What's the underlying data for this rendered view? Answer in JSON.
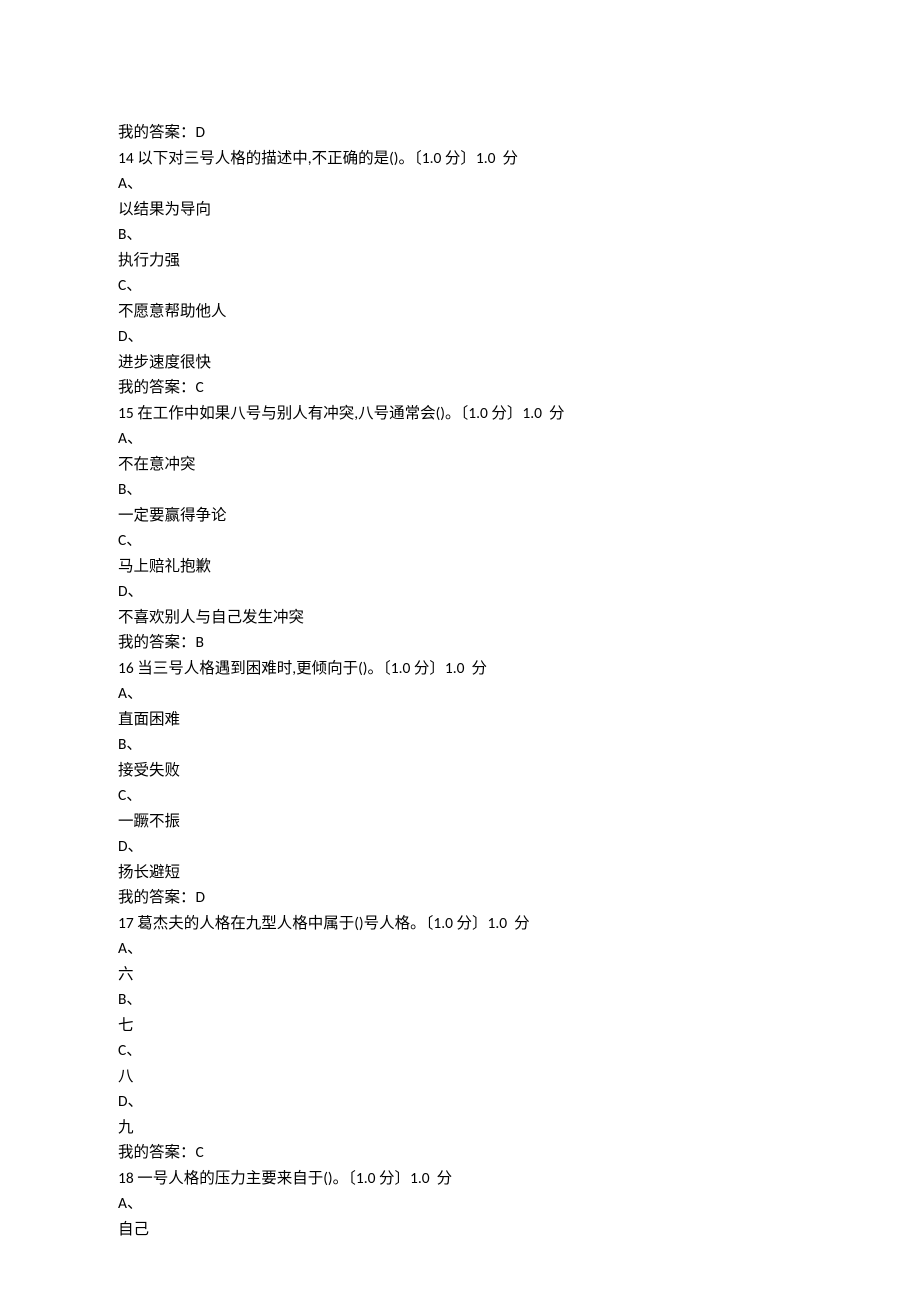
{
  "leading_answer": {
    "label": "我的答案：",
    "value": "D"
  },
  "questions": [
    {
      "num": "14",
      "text": "以下对三号人格的描述中,不正确的是()。",
      "points": "〔1.0 分〕1.0  分",
      "options": {
        "A": "以结果为导向",
        "B": "执行力强",
        "C": "不愿意帮助他人",
        "D": "进步速度很快"
      },
      "answer_label": "我的答案：",
      "answer": "C"
    },
    {
      "num": "15",
      "text": "在工作中如果八号与别人有冲突,八号通常会()。",
      "points": "〔1.0 分〕1.0  分",
      "options": {
        "A": "不在意冲突",
        "B": "一定要赢得争论",
        "C": "马上赔礼抱歉",
        "D": "不喜欢别人与自己发生冲突"
      },
      "answer_label": "我的答案：",
      "answer": "B"
    },
    {
      "num": "16",
      "text": "当三号人格遇到困难时,更倾向于()。",
      "points": "〔1.0 分〕1.0  分",
      "options": {
        "A": "直面困难",
        "B": "接受失败",
        "C": "一蹶不振",
        "D": "扬长避短"
      },
      "answer_label": "我的答案：",
      "answer": "D"
    },
    {
      "num": "17",
      "text": "葛杰夫的人格在九型人格中属于()号人格。",
      "points": "〔1.0 分〕1.0  分",
      "options": {
        "A": "六",
        "B": "七",
        "C": "八",
        "D": "九"
      },
      "answer_label": "我的答案：",
      "answer": "C"
    },
    {
      "num": "18",
      "text": "一号人格的压力主要来自于()。",
      "points": "〔1.0 分〕1.0  分",
      "options": {
        "A": "自己"
      },
      "answer_label": "",
      "answer": ""
    }
  ]
}
